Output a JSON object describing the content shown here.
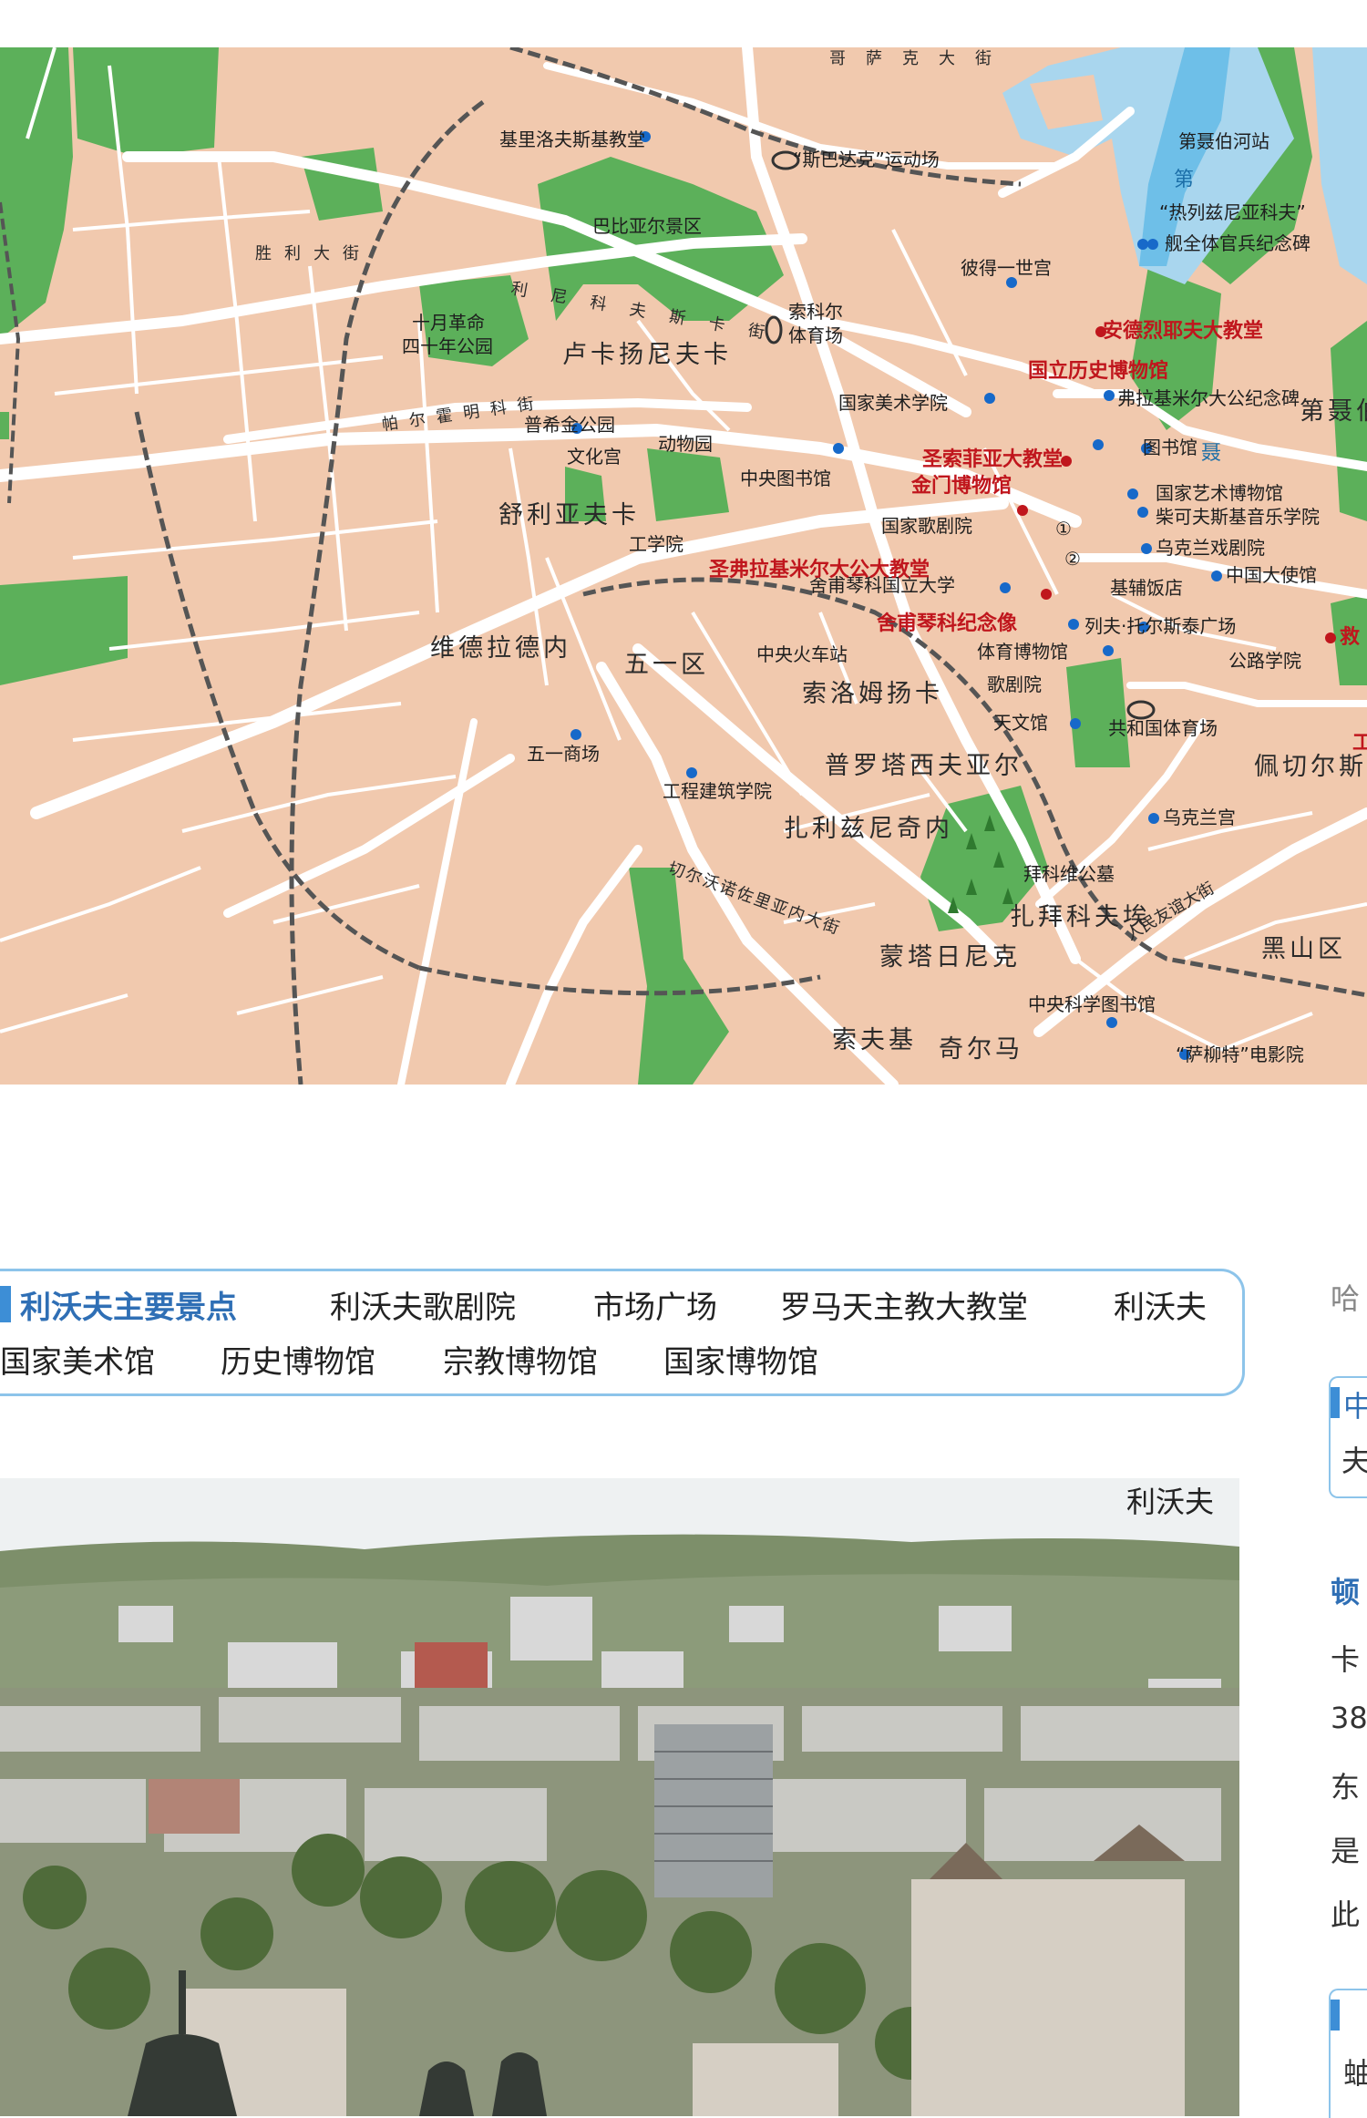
{
  "map": {
    "streets": [
      "哥萨克大街",
      "胜利大街",
      "利尼科夫斯卡街",
      "帕尔霍明科街",
      "舒利亚夫卡",
      "维德拉德内",
      "五一区",
      "索洛姆扬卡",
      "普罗塔西夫亚尔",
      "扎利兹尼奇内",
      "扎拜科夫埃",
      "蒙塔日尼克",
      "索夫基",
      "奇尔马",
      "佩切尔斯",
      "黑山区",
      "切尔沃诺佐里亚内大街",
      "人民友谊大街",
      "卢卡扬尼夫卡",
      "卢卡扬尼夫卡街"
    ],
    "places": {
      "kirillovsky": "基里洛夫斯基教堂",
      "spartak": "“斯巴达克”运动场",
      "babi_yar": "巴比亚尔景区",
      "peter_palace": "彼得一世宫",
      "october_park": "十月革命四十年公园",
      "sokol": "索科尔体育场",
      "art_academy": "国家美术学院",
      "pushkin_park": "普希金公园",
      "culture_palace": "文化宫",
      "zoo": "动物园",
      "central_library": "中央图书馆",
      "opera": "国家歌剧院",
      "polytechnic": "工学院",
      "shevchenko_univ": "舍甫琴科国立大学",
      "railway_station": "中央火车站",
      "sports_museum": "体育博物馆",
      "opera_house": "歌剧院",
      "planetarium": "天文馆",
      "republic_stadium": "共和国体育场",
      "ukraina_palace": "乌克兰宫",
      "mayday_mall": "五一商场",
      "eng_college": "工程建筑学院",
      "baikove": "拜科维公墓",
      "sci_library": "中央科学图书馆",
      "salut_cinema": "“萨柳特”电影院",
      "dnipro_station": "第聂伯河站",
      "glory": "“热列兹尼亚科夫”舰全体官兵纪念碑",
      "vladimir_monument": "弗拉基米尔大公纪念碑",
      "library": "图书馆",
      "art_museum": "国家艺术博物馆",
      "tchaikovsky": "柴可夫斯基音乐学院",
      "ukr_theatre": "乌克兰戏剧院",
      "kyiv_hotel": "基辅饭店",
      "china_embassy": "中国大使馆",
      "tolstoy_sq": "列夫·托尔斯泰广场",
      "road_inst": "公路学院",
      "pecher": "佩切尔斯",
      "republic": "共和",
      "dnipro_left": "第聂伯",
      "water1": "第",
      "water2": "聂"
    },
    "highlights": {
      "andrew": "安德烈耶夫大教堂",
      "history_museum": "国立历史博物馆",
      "sophia": "圣索菲亚大教堂",
      "golden_gate": "金门博物馆",
      "vladimir_cathedral": "圣弗拉基米尔大公大教堂",
      "shevchenko_monument": "舍甫琴科纪念像",
      "rescue": "救",
      "work": "工"
    },
    "markers": [
      "①",
      "②"
    ],
    "colors": {
      "land": "#f1c9ae",
      "park": "#5cb05a",
      "water": "#a9d6ee",
      "river": "#6ebfe8",
      "rail": "#555555",
      "road": "#ffffff",
      "poi": "#1769c9",
      "highlight": "#c0161d"
    }
  },
  "attractions": {
    "title": "利沃夫主要景点",
    "items": [
      "利沃夫歌剧院",
      "市场广场",
      "罗马天主教大教堂",
      "利沃夫",
      "国家美术馆",
      "历史博物馆",
      "宗教博物馆",
      "国家博物馆"
    ]
  },
  "photo": {
    "caption": "利沃夫"
  },
  "side": {
    "lines": [
      "哈",
      "中",
      "夫",
      "顿",
      "卡",
      "38",
      "东",
      "是",
      "此",
      "蚰"
    ]
  }
}
